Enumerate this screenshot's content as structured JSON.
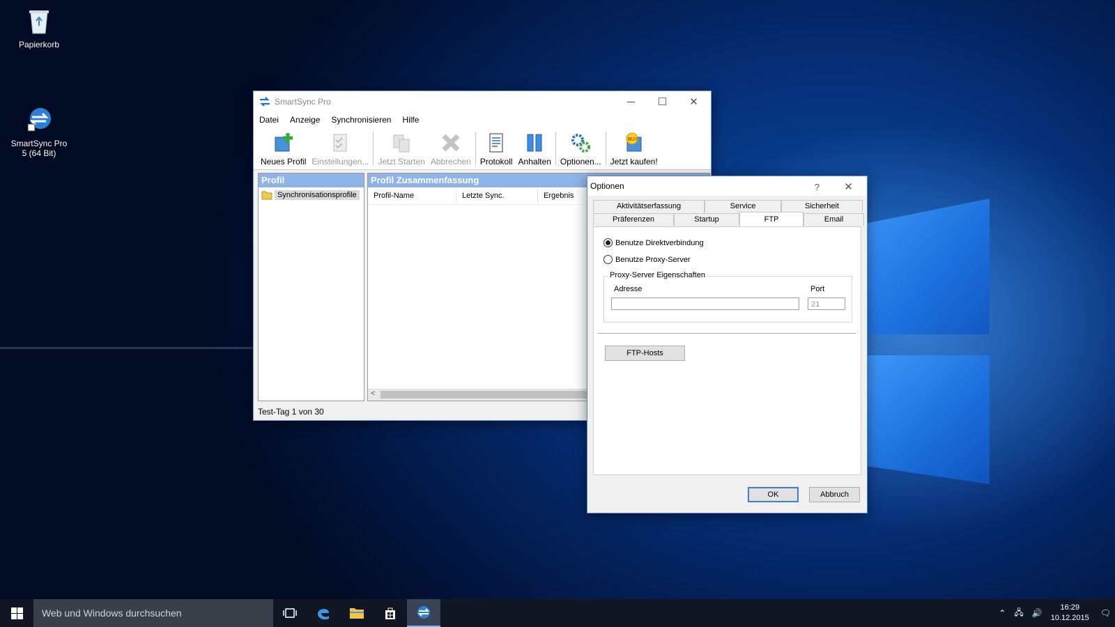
{
  "desktop": {
    "icons": [
      {
        "label": "Papierkorb",
        "icon": "recycle-bin-icon"
      },
      {
        "label": "SmartSync Pro 5 (64 Bit)",
        "icon": "smartsync-icon"
      }
    ]
  },
  "app": {
    "title": "SmartSync Pro",
    "menu": [
      "Datei",
      "Anzeige",
      "Synchronisieren",
      "Hilfe"
    ],
    "toolbar": [
      {
        "label": "Neues Profil",
        "enabled": true
      },
      {
        "label": "Einstellungen...",
        "enabled": false
      },
      {
        "label": "Jetzt Starten",
        "enabled": false
      },
      {
        "label": "Abbrechen",
        "enabled": false
      },
      {
        "label": "Protokoll",
        "enabled": true
      },
      {
        "label": "Anhalten",
        "enabled": true
      },
      {
        "label": "Optionen...",
        "enabled": true
      },
      {
        "label": "Jetzt kaufen!",
        "enabled": true
      }
    ],
    "left_panel": {
      "header": "Profil",
      "item": "Synchronisationsprofile"
    },
    "right_panel": {
      "header": "Profil Zusammenfassung",
      "columns": [
        "Profil-Name",
        "Letzte Sync.",
        "Ergebnis"
      ]
    },
    "status": "Test-Tag 1 von 30"
  },
  "options": {
    "title": "Optionen",
    "help": "?",
    "tabs_row1": [
      "Aktivitätserfassung",
      "Service",
      "Sicherheit"
    ],
    "tabs_row2": [
      "Präferenzen",
      "Startup",
      "FTP",
      "Email"
    ],
    "active_tab": "FTP",
    "radio_direct": "Benutze Direktverbindung",
    "radio_proxy": "Benutze Proxy-Server",
    "group_label": "Proxy-Server Eigenschaften",
    "address_label": "Adresse",
    "address_value": "",
    "port_label": "Port",
    "port_value": "21",
    "ftp_hosts_button": "FTP-Hosts",
    "ok": "OK",
    "cancel": "Abbruch"
  },
  "taskbar": {
    "search_placeholder": "Web und Windows durchsuchen",
    "time": "16:29",
    "date": "10.12.2015"
  },
  "colors": {
    "panel_header": "#8fb4e8",
    "accent": "#3c7fd2",
    "taskbar": "#101623"
  }
}
